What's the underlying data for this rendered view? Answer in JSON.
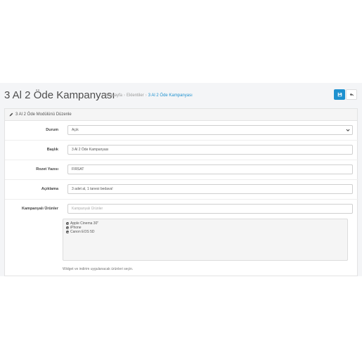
{
  "header": {
    "title": "3 Al 2 Öde Kampanyası",
    "breadcrumbs": [
      "Anasayfa",
      "Eklentiler",
      "3 Al 2 Öde Kampanyası"
    ],
    "save_icon": "save-icon",
    "back_icon": "reply-icon"
  },
  "panel": {
    "heading": "3 Al 2 Öde Modülünü Düzenle",
    "heading_icon": "pencil-icon"
  },
  "form": {
    "status_label": "Durum",
    "status_value": "Açık",
    "title_label": "Başlık",
    "title_value": "3 Al 2 Öde Kampanyası",
    "badge_label": "Rozet Yazısı",
    "badge_value": "FIRSAT",
    "desc_label": "Açıklama",
    "desc_value": "3 adet al, 1 tanesi bedava!",
    "products_label": "Kampanyalı Ürünler",
    "products_placeholder": "Kampanyalı Ürünler",
    "products": [
      "Apple Cinema 30\"",
      "iPhone",
      "Canon EOS 5D"
    ],
    "products_help": "Widget ve indirim uygulanacak ürünleri seçin."
  },
  "colors": {
    "primary": "#1e91cf",
    "page_bg": "#f4f5f7"
  }
}
